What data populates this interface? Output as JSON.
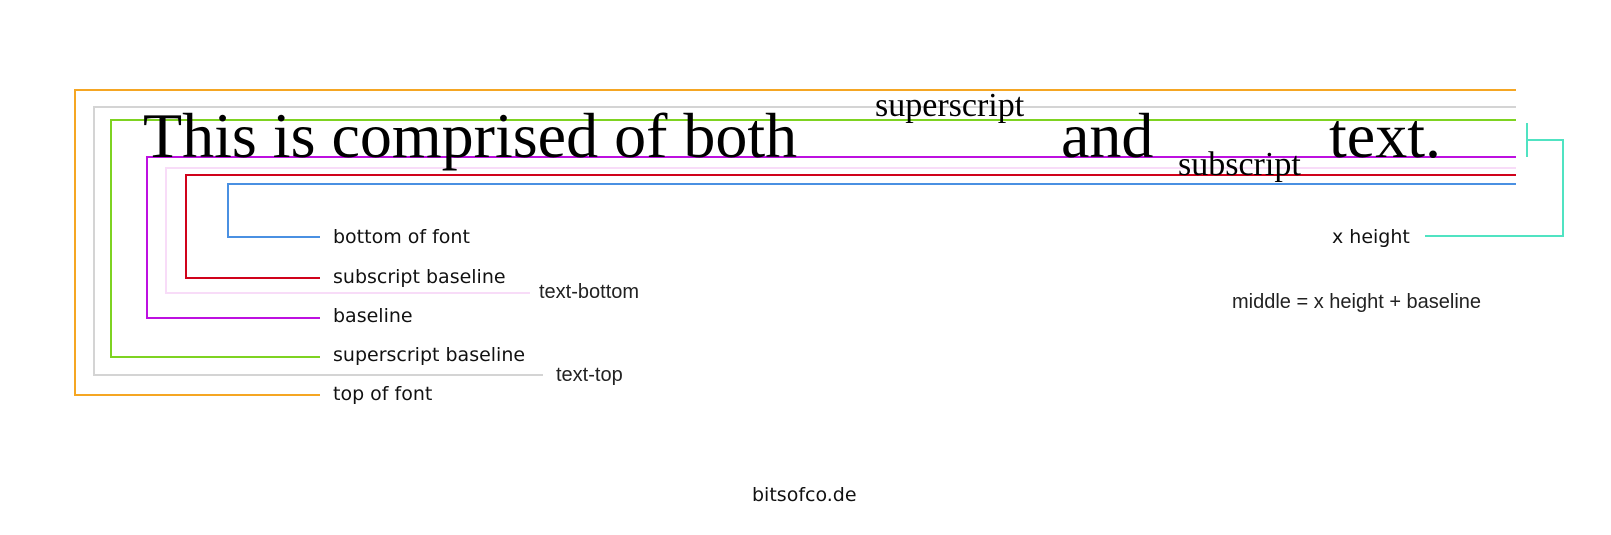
{
  "sentence": {
    "part1": "This is comprised of both",
    "superscript": "superscript",
    "part2": "and",
    "subscript": "subscript",
    "part3": "text."
  },
  "labels": {
    "bottom_of_font": "bottom of font",
    "subscript_baseline": "subscript baseline",
    "text_bottom": "text-bottom",
    "baseline": "baseline",
    "superscript_baseline": "superscript baseline",
    "text_top": "text-top",
    "top_of_font": "top of font",
    "x_height": "x height",
    "middle": "middle = x height + baseline"
  },
  "footer": "bitsofco.de",
  "colors": {
    "top_of_font": "#f5a623",
    "text_top": "#d0d0d0",
    "superscript_baseline": "#7ed321",
    "baseline": "#bd10e0",
    "text_bottom": "#f8dcf8",
    "subscript_baseline": "#d0021b",
    "bottom_of_font": "#4a90e2",
    "x_height": "#50e3c2"
  }
}
